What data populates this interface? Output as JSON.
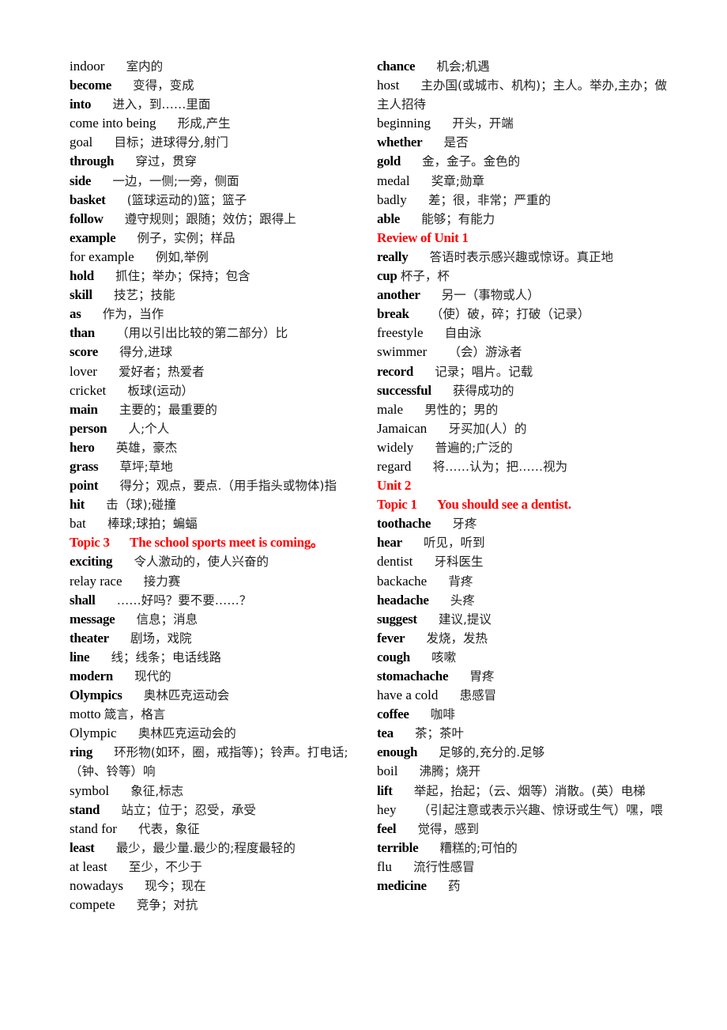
{
  "columns": [
    {
      "name": "left",
      "entries": [
        {
          "type": "entry",
          "word": "indoor",
          "bold": false,
          "def": "室内的"
        },
        {
          "type": "entry",
          "word": "become",
          "bold": true,
          "def": "变得，变成"
        },
        {
          "type": "entry",
          "word": "into",
          "bold": true,
          "def": "进入，到……里面"
        },
        {
          "type": "entry",
          "word": "come into being",
          "bold": false,
          "def": "形成,产生"
        },
        {
          "type": "entry",
          "word": "goal",
          "bold": false,
          "def": "目标；进球得分,射门"
        },
        {
          "type": "entry",
          "word": "through",
          "bold": true,
          "def": "穿过，贯穿"
        },
        {
          "type": "entry",
          "word": "side",
          "bold": true,
          "def": "一边，一侧;一旁，侧面"
        },
        {
          "type": "entry",
          "word": "basket",
          "bold": true,
          "def": "(篮球运动的)篮；篮子"
        },
        {
          "type": "entry",
          "word": "follow",
          "bold": true,
          "def": "遵守规则；跟随；效仿；跟得上"
        },
        {
          "type": "entry",
          "word": "example",
          "bold": true,
          "def": "例子，实例；样品"
        },
        {
          "type": "entry",
          "word": "for example",
          "bold": false,
          "def": "例如,举例"
        },
        {
          "type": "entry",
          "word": "hold",
          "bold": true,
          "def": "抓住；举办；保持；包含"
        },
        {
          "type": "entry",
          "word": "skill",
          "bold": true,
          "def": "技艺；技能"
        },
        {
          "type": "entry",
          "word": "as",
          "bold": true,
          "def": "作为，当作"
        },
        {
          "type": "entry",
          "word": "than",
          "bold": true,
          "def": "（用以引出比较的第二部分）比"
        },
        {
          "type": "entry",
          "word": "score",
          "bold": true,
          "def": "得分,进球"
        },
        {
          "type": "entry",
          "word": "lover",
          "bold": false,
          "def": "爱好者；热爱者"
        },
        {
          "type": "entry",
          "word": "cricket",
          "bold": false,
          "def": "板球(运动）"
        },
        {
          "type": "entry",
          "word": "main",
          "bold": true,
          "def": "主要的；最重要的"
        },
        {
          "type": "entry",
          "word": "person",
          "bold": true,
          "def": "人;个人"
        },
        {
          "type": "entry",
          "word": "hero",
          "bold": true,
          "def": "英雄，豪杰"
        },
        {
          "type": "entry",
          "word": "grass",
          "bold": true,
          "def": "草坪;草地"
        },
        {
          "type": "entry",
          "word": "point",
          "bold": true,
          "def": "得分；观点，要点.（用手指头或物体)指"
        },
        {
          "type": "entry",
          "word": "hit",
          "bold": true,
          "def": "击（球);碰撞"
        },
        {
          "type": "entry",
          "word": "bat",
          "bold": false,
          "def": "棒球;球拍；蝙蝠"
        },
        {
          "type": "heading",
          "label": "Topic 3",
          "title": "The school sports meet is coming。"
        },
        {
          "type": "entry",
          "word": "exciting",
          "bold": true,
          "def": "令人激动的，使人兴奋的"
        },
        {
          "type": "entry",
          "word": "relay race",
          "bold": false,
          "def": "接力赛"
        },
        {
          "type": "entry",
          "word": "shall",
          "bold": true,
          "def": "……好吗？要不要……？"
        },
        {
          "type": "entry",
          "word": "message",
          "bold": true,
          "def": "信息；消息"
        },
        {
          "type": "entry",
          "word": "theater",
          "bold": true,
          "def": "剧场，戏院"
        },
        {
          "type": "entry",
          "word": "line",
          "bold": true,
          "def": "线；线条；电话线路"
        },
        {
          "type": "entry",
          "word": "modern",
          "bold": true,
          "def": "现代的"
        },
        {
          "type": "entry",
          "word": "Olympics",
          "bold": true,
          "def": "奥林匹克运动会"
        },
        {
          "type": "entry",
          "word": "motto",
          "bold": false,
          "def": "箴言，格言",
          "tight": true
        },
        {
          "type": "entry",
          "word": "Olympic",
          "bold": false,
          "def": "奥林匹克运动会的"
        },
        {
          "type": "entry",
          "word": "ring",
          "bold": true,
          "def": "环形物(如环，圈，戒指等)；铃声。打电话;（钟、铃等）响"
        },
        {
          "type": "entry",
          "word": "symbol",
          "bold": false,
          "def": "象征,标志"
        },
        {
          "type": "entry",
          "word": "stand",
          "bold": true,
          "def": "站立；位于；忍受，承受"
        },
        {
          "type": "entry",
          "word": "stand for",
          "bold": false,
          "def": "代表，象征"
        },
        {
          "type": "entry",
          "word": "least",
          "bold": true,
          "def": "最少，最少量.最少的;程度最轻的"
        },
        {
          "type": "entry",
          "word": "at least",
          "bold": false,
          "def": "至少，不少于"
        },
        {
          "type": "entry",
          "word": "nowadays",
          "bold": false,
          "def": "现今；现在"
        },
        {
          "type": "entry",
          "word": "compete",
          "bold": false,
          "def": "竞争；对抗"
        }
      ]
    },
    {
      "name": "right",
      "entries": [
        {
          "type": "entry",
          "word": "chance",
          "bold": true,
          "def": "机会;机遇"
        },
        {
          "type": "entry",
          "word": "host",
          "bold": false,
          "def": "主办国(或城市、机构)；主人。举办,主办；做主人招待"
        },
        {
          "type": "entry",
          "word": "beginning",
          "bold": false,
          "def": "开头，开端"
        },
        {
          "type": "entry",
          "word": "whether",
          "bold": true,
          "def": "是否"
        },
        {
          "type": "entry",
          "word": "gold",
          "bold": true,
          "def": "金，金子。金色的"
        },
        {
          "type": "entry",
          "word": "medal",
          "bold": false,
          "def": "奖章;勋章"
        },
        {
          "type": "entry",
          "word": "badly",
          "bold": false,
          "def": "差；很，非常；严重的"
        },
        {
          "type": "entry",
          "word": "able",
          "bold": true,
          "def": "能够；有能力"
        },
        {
          "type": "heading",
          "label": "Review of Unit 1",
          "title": ""
        },
        {
          "type": "entry",
          "word": "really",
          "bold": true,
          "def": "答语时表示感兴趣或惊讶。真正地"
        },
        {
          "type": "entry",
          "word": "cup",
          "bold": true,
          "def": "杯子，杯",
          "tight": true
        },
        {
          "type": "entry",
          "word": "another",
          "bold": true,
          "def": "另一（事物或人）"
        },
        {
          "type": "entry",
          "word": "break",
          "bold": true,
          "def": "（使）破，碎；打破（记录）"
        },
        {
          "type": "entry",
          "word": "freestyle",
          "bold": false,
          "def": "自由泳"
        },
        {
          "type": "entry",
          "word": "swimmer",
          "bold": false,
          "def": "（会）游泳者"
        },
        {
          "type": "entry",
          "word": "record",
          "bold": true,
          "def": "记录；唱片。记载"
        },
        {
          "type": "entry",
          "word": "successful",
          "bold": true,
          "def": "获得成功的"
        },
        {
          "type": "entry",
          "word": "male",
          "bold": false,
          "def": "男性的；男的"
        },
        {
          "type": "entry",
          "word": "Jamaican",
          "bold": false,
          "def": "牙买加(人）的"
        },
        {
          "type": "entry",
          "word": "widely",
          "bold": false,
          "def": "普遍的;广泛的"
        },
        {
          "type": "entry",
          "word": "regard",
          "bold": false,
          "def": "将……认为；把……视为"
        },
        {
          "type": "heading",
          "label": "Unit 2",
          "title": ""
        },
        {
          "type": "heading",
          "label": "Topic 1",
          "title": "You should see a dentist."
        },
        {
          "type": "entry",
          "word": "toothache",
          "bold": true,
          "def": "牙疼"
        },
        {
          "type": "entry",
          "word": "hear",
          "bold": true,
          "def": "听见，听到"
        },
        {
          "type": "entry",
          "word": "dentist",
          "bold": false,
          "def": "牙科医生"
        },
        {
          "type": "entry",
          "word": "backache",
          "bold": false,
          "def": "背疼"
        },
        {
          "type": "entry",
          "word": "headache",
          "bold": true,
          "def": "头疼"
        },
        {
          "type": "entry",
          "word": "suggest",
          "bold": true,
          "def": "建议,提议"
        },
        {
          "type": "entry",
          "word": "fever",
          "bold": true,
          "def": "发烧，发热"
        },
        {
          "type": "entry",
          "word": "cough",
          "bold": true,
          "def": "咳嗽"
        },
        {
          "type": "entry",
          "word": "stomachache",
          "bold": true,
          "def": "胃疼"
        },
        {
          "type": "entry",
          "word": "have a cold",
          "bold": false,
          "def": "患感冒"
        },
        {
          "type": "entry",
          "word": "coffee",
          "bold": true,
          "def": "咖啡"
        },
        {
          "type": "entry",
          "word": "tea",
          "bold": true,
          "def": "茶；茶叶"
        },
        {
          "type": "entry",
          "word": "enough",
          "bold": true,
          "def": "足够的,充分的.足够"
        },
        {
          "type": "entry",
          "word": "boil",
          "bold": false,
          "def": "沸腾；烧开"
        },
        {
          "type": "entry",
          "word": "lift",
          "bold": true,
          "def": "举起，抬起；（云、烟等）消散。(英）电梯"
        },
        {
          "type": "entry",
          "word": "hey",
          "bold": false,
          "def": "（引起注意或表示兴趣、惊讶或生气）嘿，喂"
        },
        {
          "type": "entry",
          "word": "feel",
          "bold": true,
          "def": "觉得，感到"
        },
        {
          "type": "entry",
          "word": "terrible",
          "bold": true,
          "def": "糟糕的;可怕的"
        },
        {
          "type": "entry",
          "word": "flu",
          "bold": false,
          "def": "流行性感冒"
        },
        {
          "type": "entry",
          "word": "medicine",
          "bold": true,
          "def": "药"
        }
      ]
    }
  ],
  "colors": {
    "heading": "#ff0000",
    "text": "#000000"
  }
}
